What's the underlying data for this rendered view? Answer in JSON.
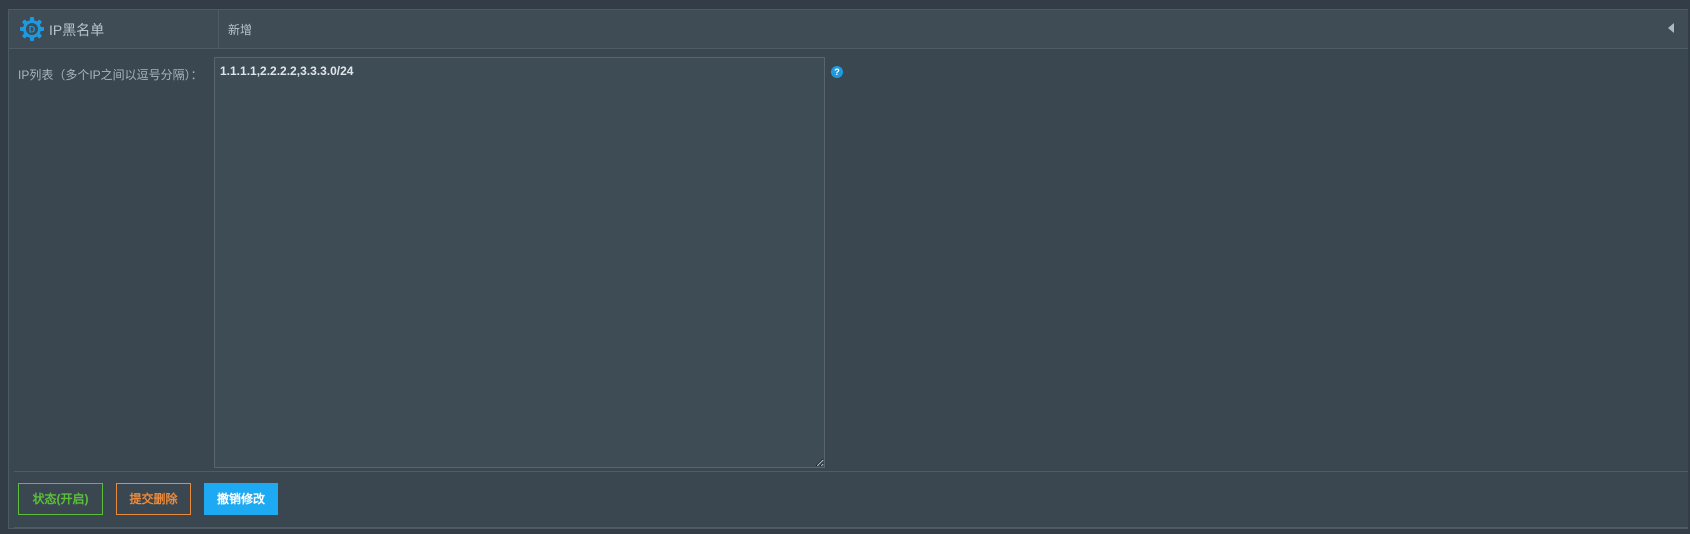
{
  "header": {
    "title": "IP黑名单",
    "tab": "新增",
    "logo_icon": "gear-logo-icon",
    "collapse_icon": "caret-left-icon"
  },
  "form": {
    "ip_list_label": "IP列表（多个IP之间以逗号分隔）：",
    "ip_list_value": "1.1.1.1,2.2.2.2,3.3.3.0/24",
    "help_icon": "question-circle-icon"
  },
  "buttons": {
    "status_label": "状态(开启)",
    "delete_label": "提交删除",
    "revert_label": "撤销修改"
  },
  "colors": {
    "background": "#3a4650",
    "accent_blue": "#1ea9f3",
    "status_green": "#5bbf3a",
    "delete_orange": "#e98a3c"
  }
}
